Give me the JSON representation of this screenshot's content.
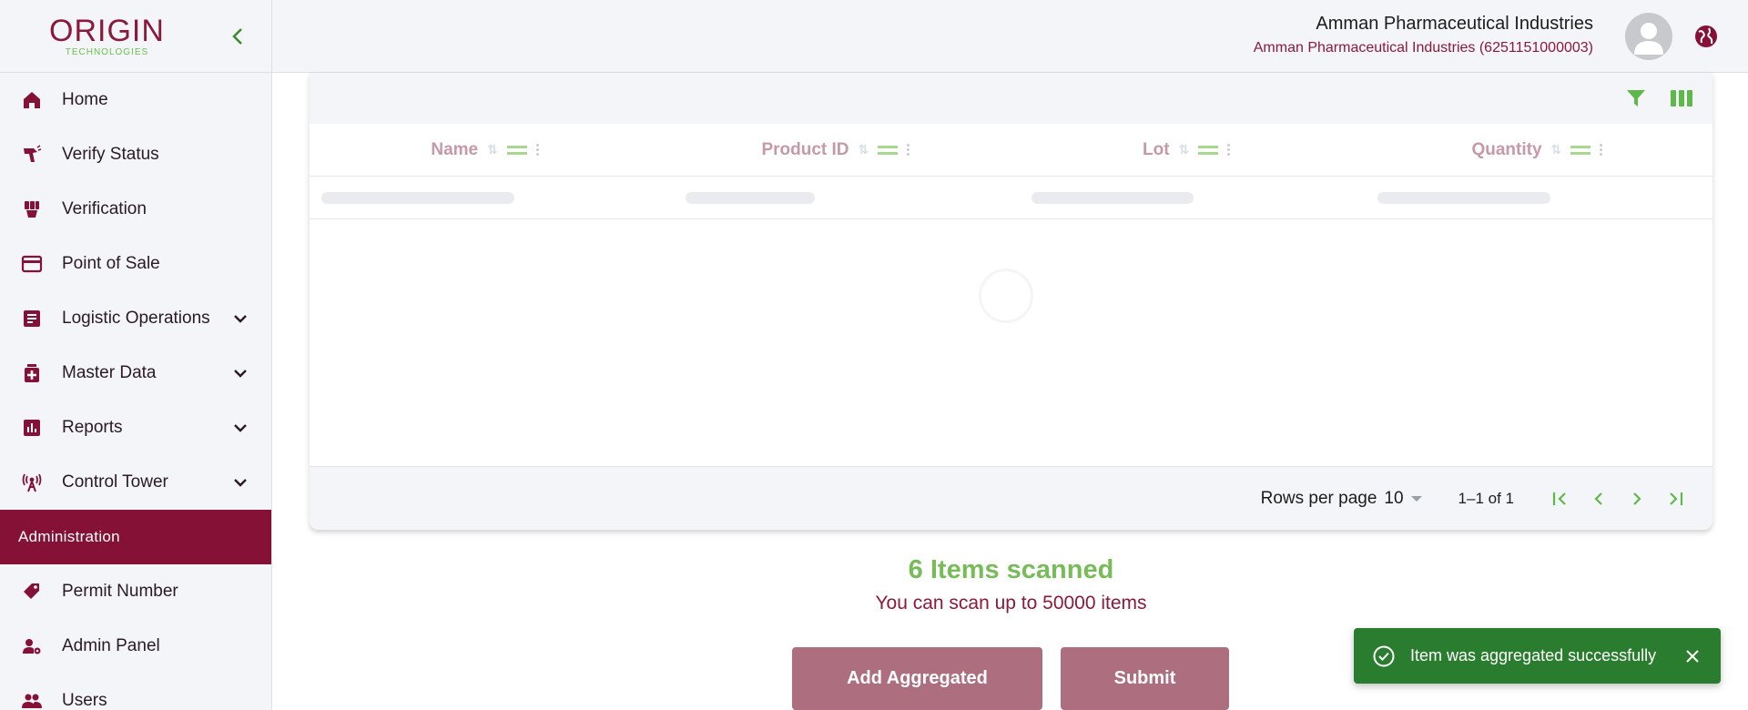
{
  "brand": {
    "logo_text": "ORIGIN",
    "logo_sub": "TECHNOLOGIES"
  },
  "sidebar": {
    "items": [
      {
        "label": "Home",
        "icon": "home-icon"
      },
      {
        "label": "Verify Status",
        "icon": "scan-gun-icon"
      },
      {
        "label": "Verification",
        "icon": "verification-icon"
      },
      {
        "label": "Point of Sale",
        "icon": "credit-card-icon"
      },
      {
        "label": "Logistic Operations",
        "icon": "document-icon",
        "expandable": true
      },
      {
        "label": "Master Data",
        "icon": "medical-box-icon",
        "expandable": true
      },
      {
        "label": "Reports",
        "icon": "bar-chart-icon",
        "expandable": true
      },
      {
        "label": "Control Tower",
        "icon": "antenna-icon",
        "expandable": true
      },
      {
        "label": "Administration",
        "active": true
      },
      {
        "label": "Permit Number",
        "icon": "tag-icon"
      },
      {
        "label": "Admin Panel",
        "icon": "admin-user-icon"
      },
      {
        "label": "Users",
        "icon": "users-icon"
      }
    ]
  },
  "header": {
    "user_name": "Amman Pharmaceutical Industries",
    "user_org": "Amman Pharmaceutical Industries (6251151000003)"
  },
  "table": {
    "columns": [
      "Name",
      "Product ID",
      "Lot",
      "Quantity"
    ],
    "rows_per_page_label": "Rows per page",
    "rows_per_page_value": "10",
    "range_text": "1–1 of 1"
  },
  "scan": {
    "count_text": "6 Items scanned",
    "limit_text": "You can scan up to 50000 items"
  },
  "buttons": {
    "add_aggregated": "Add Aggregated",
    "submit": "Submit"
  },
  "toast": {
    "message": "Item was aggregated successfully"
  },
  "colors": {
    "brand": "#851236",
    "accent_green": "#78bc5a",
    "toast_green": "#2a7d2e",
    "button_muted": "#ad6e80"
  }
}
